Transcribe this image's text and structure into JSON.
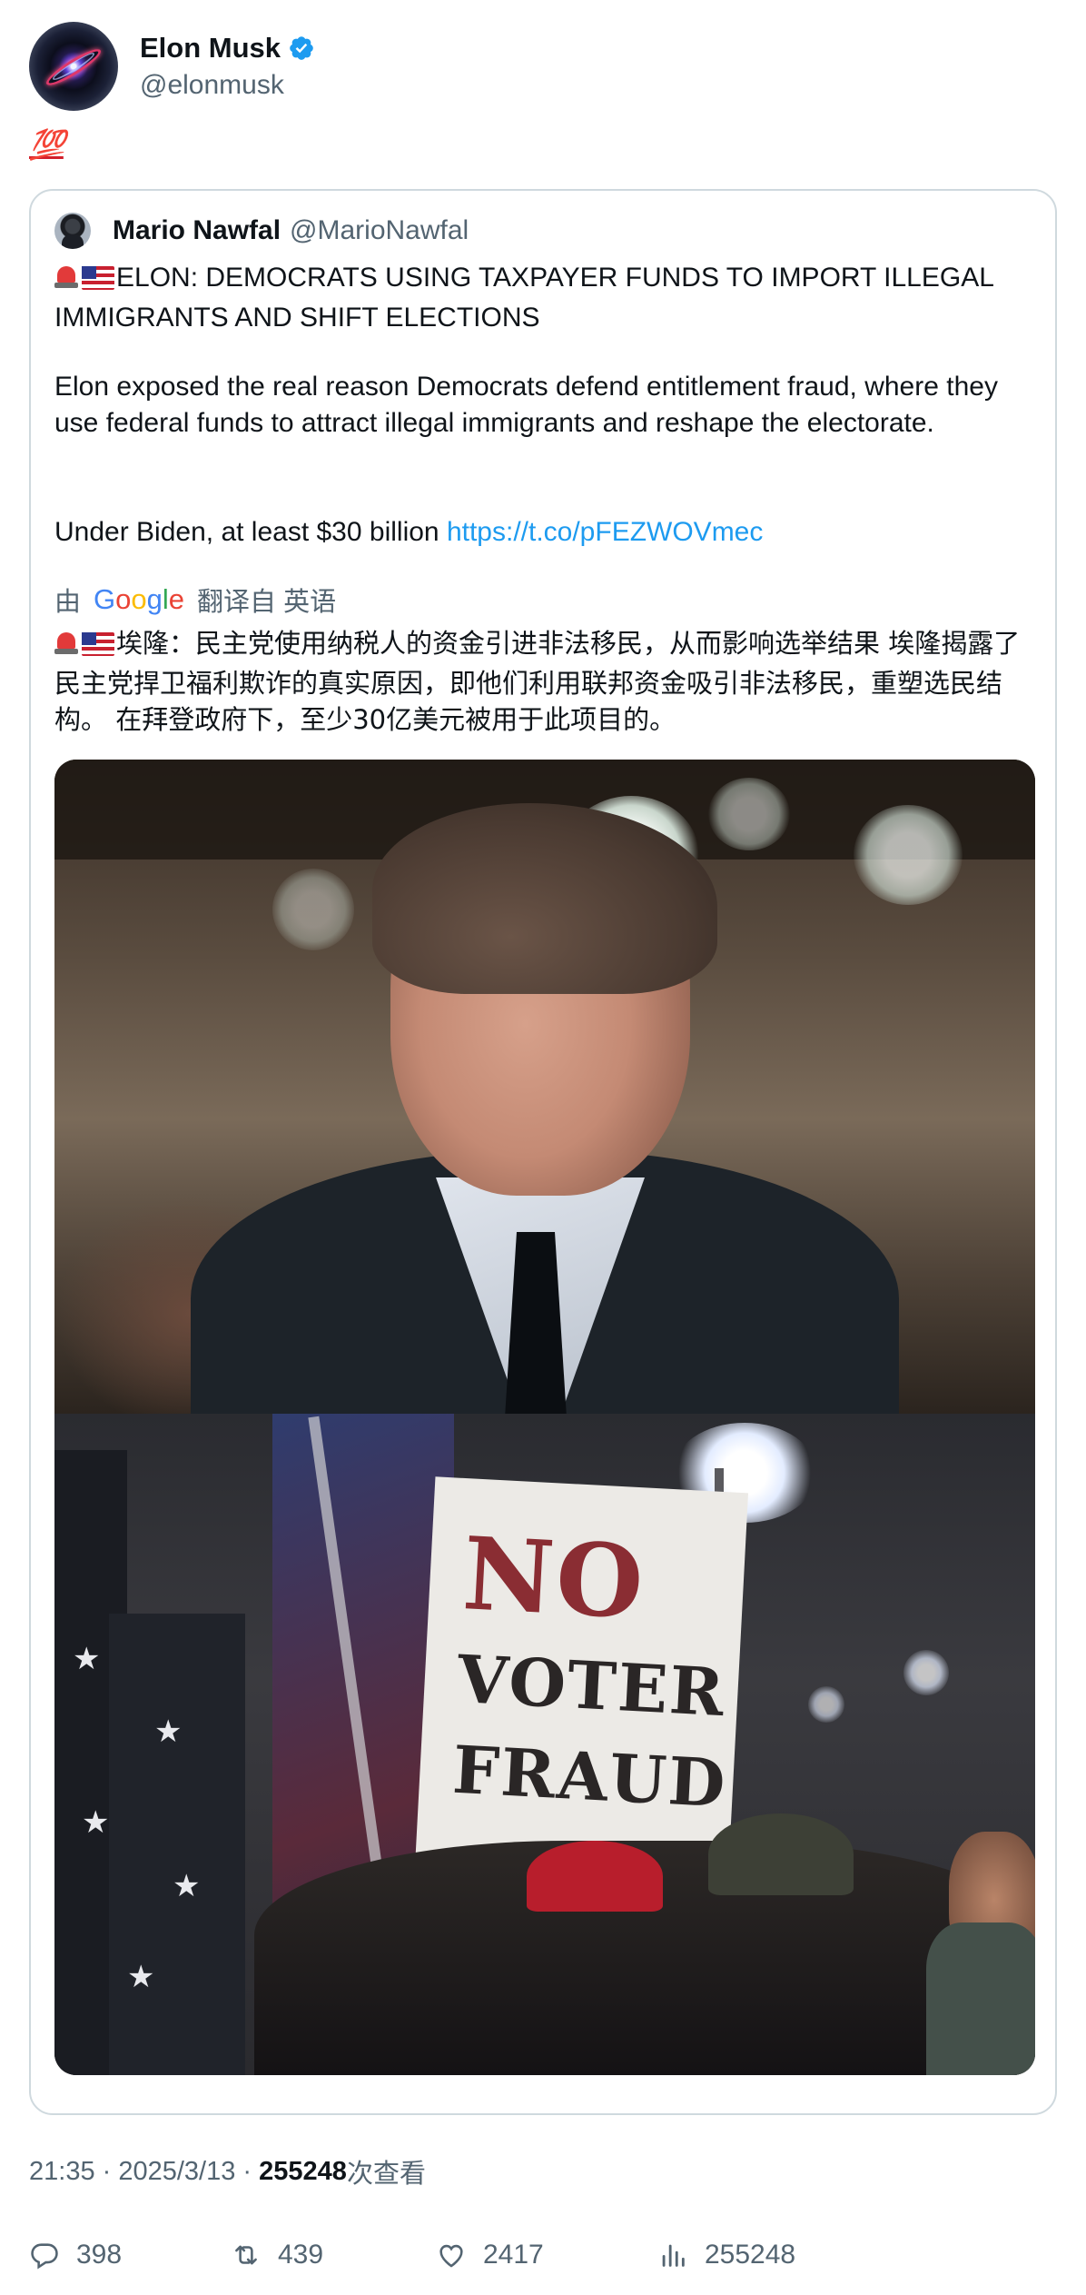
{
  "author": {
    "name": "Elon Musk",
    "handle": "@elonmusk",
    "verified_icon": "verified-badge-icon",
    "badge_color": "#1d9bf0"
  },
  "post": {
    "emoji_text": "💯"
  },
  "quoted": {
    "name": "Mario Nawfal",
    "handle": "@MarioNawfal",
    "headline": "ELON: DEMOCRATS USING TAXPAYER FUNDS TO IMPORT ILLEGAL IMMIGRANTS AND SHIFT ELECTIONS",
    "body": "Elon exposed the real reason Democrats defend entitlement fraud, where they use federal funds to attract illegal immigrants and reshape the electorate.",
    "under_biden": "Under Biden, at least $30 billion",
    "link": "https://t.co/pFEZWOVmec",
    "translation": {
      "prefix": "由",
      "provider": "Google",
      "suffix": "翻译自 英语",
      "text": "埃隆：民主党使用纳税人的资金引进非法移民，从而影响选举结果 埃隆揭露了民主党捍卫福利欺诈的真实原因，即他们利用联邦资金吸引非法移民，重塑选民结构。 在拜登政府下，至少30亿美元被用于此项目的。"
    },
    "sign_lines": [
      "NO",
      "VOTER",
      "FRAUD"
    ]
  },
  "meta": {
    "time": "21:35",
    "date": "2025/3/13",
    "views": "255248",
    "views_suffix": "次查看"
  },
  "actions": {
    "replies": "398",
    "reposts": "439",
    "likes": "2417",
    "views": "255248"
  },
  "colors": {
    "text": "#0f1419",
    "secondary": "#536471",
    "link": "#1d9bf0",
    "border": "#cfd9de"
  }
}
